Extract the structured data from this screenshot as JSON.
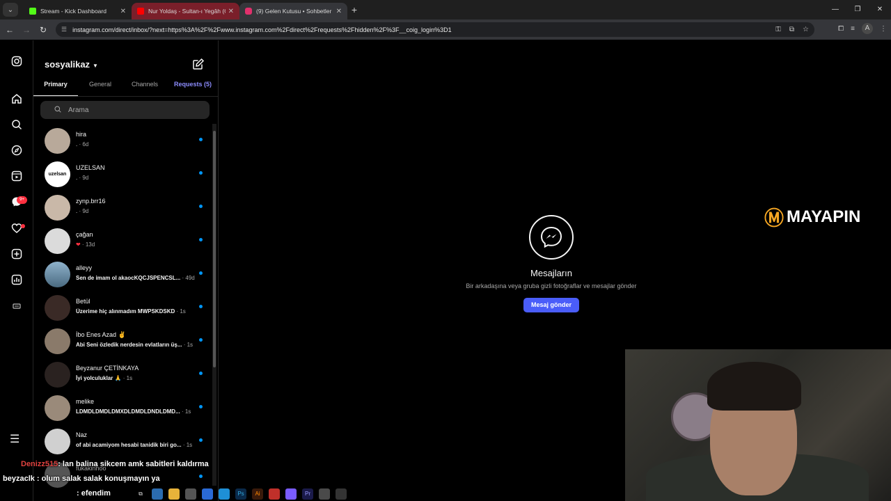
{
  "browser": {
    "tabs": [
      {
        "title": "Stream - Kick Dashboard",
        "favicon_color": "#53fc18"
      },
      {
        "title": "Nur Yoldaş - Sultan-ı Yegâh (Of",
        "favicon_color": "#ff0000"
      },
      {
        "title": "(9) Gelen Kutusu • Sohbetler",
        "favicon_color": "#e1306c"
      }
    ],
    "url": "instagram.com/direct/inbox/?next=https%3A%2F%2Fwww.instagram.com%2Fdirect%2Frequests%2Fhidden%2F%3F__coig_login%3D1",
    "profile_initial": "A"
  },
  "sidebar": {
    "notification_badge": "9+",
    "icons": [
      "instagram-icon",
      "home-icon",
      "search-icon",
      "explore-icon",
      "reels-icon",
      "messenger-icon",
      "heart-icon",
      "create-icon",
      "dashboard-icon",
      "threads-icon",
      "menu-icon"
    ]
  },
  "inbox": {
    "username": "sosyalikaz",
    "tabs": {
      "primary": "Primary",
      "general": "General",
      "channels": "Channels",
      "requests": "Requests (5)"
    },
    "search_placeholder": "Arama",
    "conversations": [
      {
        "name": "hira",
        "preview": ".",
        "time": " · 6d",
        "bold": false,
        "avatar_color": "#b8a99a"
      },
      {
        "name": "UZELSAN",
        "preview": ".",
        "time": " · 9d",
        "bold": false,
        "avatar_color": "#ffffff",
        "avatar_text": "uzelsan"
      },
      {
        "name": "zynp.brr16",
        "preview": ".",
        "time": " · 9d",
        "bold": false,
        "avatar_color": "#c9b8a8"
      },
      {
        "name": "çağan",
        "preview": "❤",
        "time": " · 13d",
        "bold": false,
        "avatar_color": "#dbdbdb"
      },
      {
        "name": "alleyy",
        "preview": "Sen de imam ol akaocKQCJSPENCSL...",
        "time": " · 49d",
        "bold": true,
        "avatar_color": "#6a8fa8"
      },
      {
        "name": "Betül",
        "preview": "Üzerime hiç alınmadım MWPSKDSKD",
        "time": " · 1s",
        "bold": true,
        "avatar_color": "#3a2a26"
      },
      {
        "name": "İbo Enes Azad ✌",
        "preview": "Abi Seni özledik nerdesin evlatların üş...",
        "time": " · 1s",
        "bold": true,
        "avatar_color": "#8a7a6a"
      },
      {
        "name": "Beyzanur ÇETİNKAYA",
        "preview": "İyi yolculuklar 🙏",
        "time": " · 1s",
        "bold": true,
        "avatar_color": "#2a2220"
      },
      {
        "name": "melike",
        "preview": "LDMDLDMDLDMXDLDMDLDNDLDMD...",
        "time": " · 1s",
        "bold": true,
        "avatar_color": "#9a8a7a"
      },
      {
        "name": "Naz",
        "preview": "of abi acamiyom hesabi tanidik biri go...",
        "time": " · 1s",
        "bold": true,
        "avatar_color": "#d0d0d0"
      },
      {
        "name": "fukakinhoo",
        "preview": "",
        "time": "",
        "bold": false,
        "avatar_color": "#555555"
      }
    ]
  },
  "main": {
    "title": "Mesajların",
    "subtitle": "Bir arkadaşına veya gruba gizli fotoğraflar ve mesajlar gönder",
    "button": "Mesaj gönder"
  },
  "overlay": {
    "logo_text": "MAYAPIN",
    "chat": [
      {
        "user": "Denizz515",
        "message": ": lan balina sikcem amk sabitleri kaldırma"
      },
      {
        "user": "beyzaclk",
        "message": " : olum salak salak konuşmayın ya"
      },
      {
        "user": "",
        "message": ": efendim"
      }
    ]
  },
  "colors": {
    "accent": "#4a5df9",
    "unread": "#0095f6",
    "requests": "#8d8dff"
  }
}
